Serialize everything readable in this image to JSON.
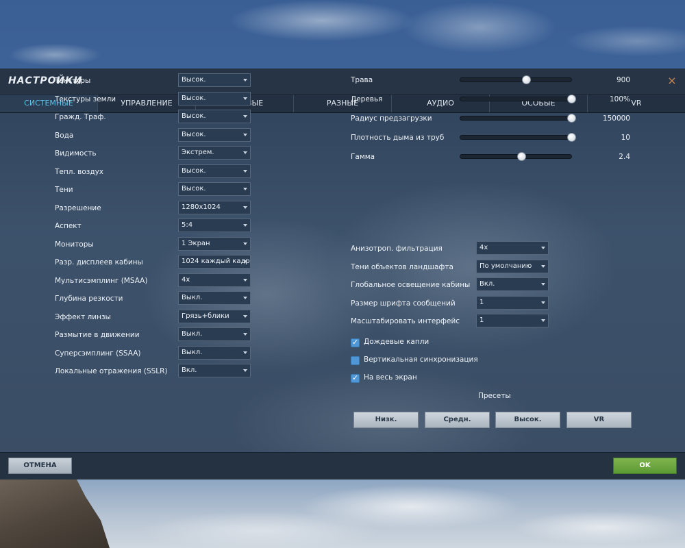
{
  "window": {
    "title": "НАСТРОЙКИ",
    "close_glyph": "×"
  },
  "tabs": [
    {
      "label": "СИСТЕМНЫЕ",
      "active": true
    },
    {
      "label": "УПРАВЛЕНИЕ"
    },
    {
      "label": "ИГРОВЫЕ"
    },
    {
      "label": "РАЗНЫЕ"
    },
    {
      "label": "АУДИО"
    },
    {
      "label": "ОСОБЫЕ"
    },
    {
      "label": "VR"
    }
  ],
  "graphics": [
    {
      "label": "Текстуры",
      "value": "Высок."
    },
    {
      "label": "Текстуры земли",
      "value": "Высок."
    },
    {
      "label": "Гражд. Траф.",
      "value": "Высок."
    },
    {
      "label": "Вода",
      "value": "Высок."
    },
    {
      "label": "Видимость",
      "value": "Экстрем."
    },
    {
      "label": "Тепл. воздух",
      "value": "Высок."
    },
    {
      "label": "Тени",
      "value": "Высок."
    },
    {
      "label": "Разрешение",
      "value": "1280x1024"
    },
    {
      "label": "Аспект",
      "value": "5:4"
    },
    {
      "label": "Мониторы",
      "value": "1 Экран"
    },
    {
      "label": "Разр. дисплеев кабины",
      "value": "1024 каждый кадр"
    },
    {
      "label": "Мультисэмплинг (MSAA)",
      "value": "4x"
    },
    {
      "label": "Глубина резкости",
      "value": "Выкл."
    },
    {
      "label": "Эффект линзы",
      "value": "Грязь+блики"
    },
    {
      "label": "Размытие в движении",
      "value": "Выкл."
    },
    {
      "label": "Суперсэмплинг (SSAA)",
      "value": "Выкл."
    },
    {
      "label": "Локальные отражения (SSLR)",
      "value": "Вкл."
    }
  ],
  "sliders": [
    {
      "label": "Трава",
      "value": "900",
      "level": 0.59
    },
    {
      "label": "Деревья",
      "value": "100%",
      "level": 1.0
    },
    {
      "label": "Радиус предзагрузки",
      "value": "150000",
      "level": 1.0
    },
    {
      "label": "Плотность дыма из труб",
      "value": "10",
      "level": 1.0
    },
    {
      "label": "Гамма",
      "value": "2.4",
      "level": 0.55
    }
  ],
  "extra_selects": [
    {
      "label": "Анизотроп. фильтрация",
      "value": "4x"
    },
    {
      "label": "Тени объектов ландшафта",
      "value": "По умолчанию"
    },
    {
      "label": "Глобальное освещение кабины",
      "value": "Вкл."
    },
    {
      "label": "Размер шрифта сообщений",
      "value": "1"
    },
    {
      "label": "Масштабировать интерфейс",
      "value": "1"
    }
  ],
  "checkboxes": [
    {
      "label": "Дождевые капли",
      "checked": true,
      "mark": "✓"
    },
    {
      "label": "Вертикальная синхронизация",
      "checked": false,
      "mark": ""
    },
    {
      "label": "На весь экран",
      "checked": true,
      "mark": "✓"
    }
  ],
  "presets": {
    "label": "Пресеты",
    "buttons": [
      "Низк.",
      "Средн.",
      "Высок.",
      "VR"
    ]
  },
  "footer": {
    "cancel_label": "ОТМЕНА",
    "ok_label": "OK"
  },
  "colors": {
    "accent_tab": "#5fc3ea",
    "ok_green": "#6aa63f",
    "checkbox_blue": "#4f97d6",
    "close_orange": "#d08a4a"
  },
  "icons": {
    "close": "close-icon",
    "dropdown": "chevron-down-icon",
    "check": "checkmark-icon"
  }
}
